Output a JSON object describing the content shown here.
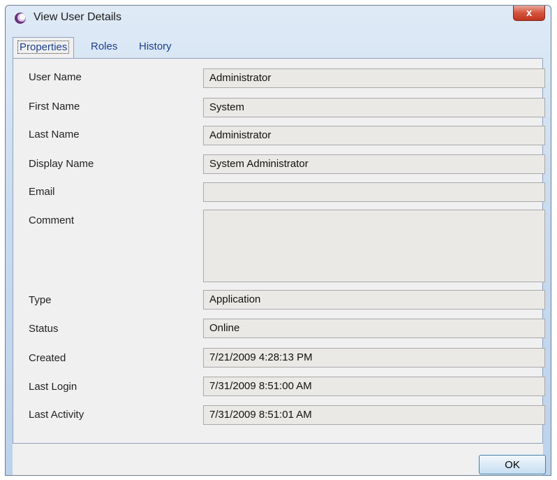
{
  "window": {
    "title": "View User Details",
    "close_label": "x"
  },
  "tabs": [
    {
      "label": "Properties"
    },
    {
      "label": "Roles"
    },
    {
      "label": "History"
    }
  ],
  "fields": {
    "user_name": {
      "label": "User Name",
      "value": "Administrator"
    },
    "first_name": {
      "label": "First Name",
      "value": "System"
    },
    "last_name": {
      "label": "Last Name",
      "value": "Administrator"
    },
    "display_name": {
      "label": "Display Name",
      "value": "System Administrator"
    },
    "email": {
      "label": "Email",
      "value": ""
    },
    "comment": {
      "label": "Comment",
      "value": ""
    },
    "type": {
      "label": "Type",
      "value": "Application"
    },
    "status": {
      "label": "Status",
      "value": "Online"
    },
    "created": {
      "label": "Created",
      "value": "7/21/2009 4:28:13 PM"
    },
    "last_login": {
      "label": "Last Login",
      "value": "7/31/2009 8:51:00 AM"
    },
    "last_activity": {
      "label": "Last Activity",
      "value": "7/31/2009 8:51:01 AM"
    }
  },
  "footer": {
    "ok_label": "OK"
  },
  "colors": {
    "accent": "#1b3f8f",
    "close": "#c2351f"
  }
}
